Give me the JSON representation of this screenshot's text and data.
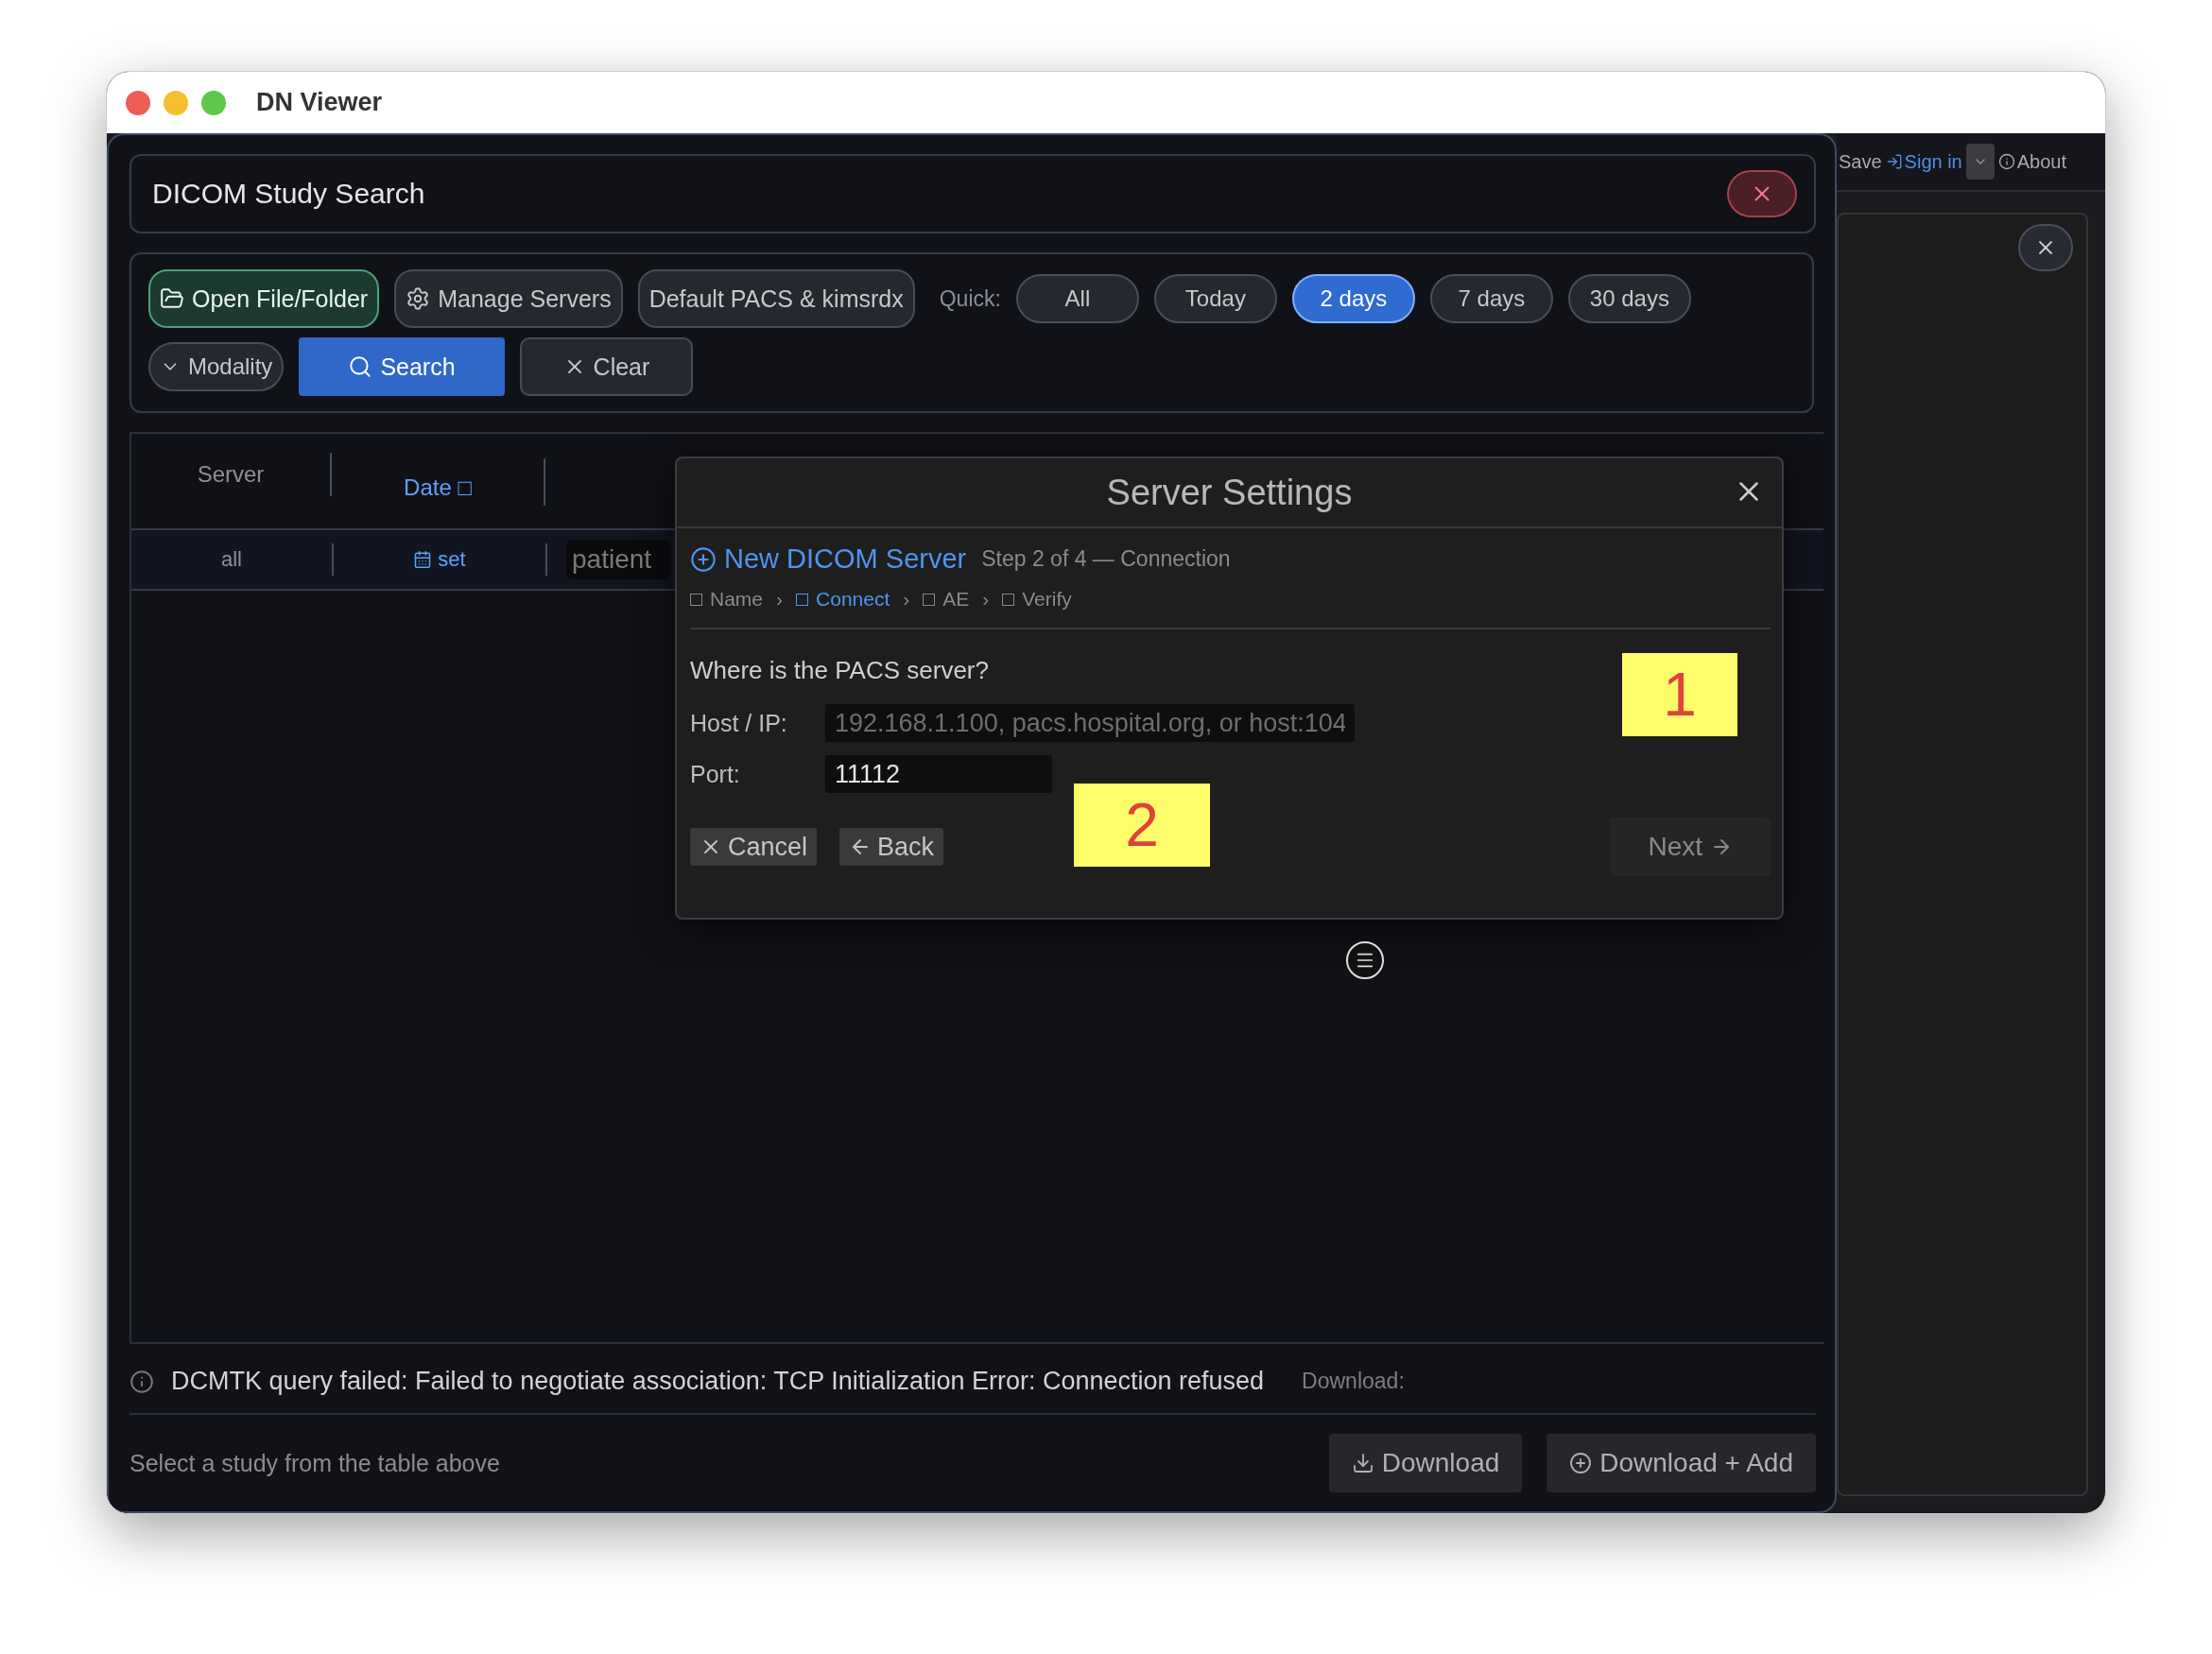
{
  "window": {
    "title": "DN Viewer"
  },
  "search_panel": {
    "title": "DICOM Study Search",
    "open_button": "Open File/Folder",
    "manage_button": "Manage Servers",
    "server_button": "Default PACS & kimsrdx",
    "quick_label": "Quick:",
    "quick_ranges": [
      {
        "label": "All",
        "selected": false
      },
      {
        "label": "Today",
        "selected": false
      },
      {
        "label": "2 days",
        "selected": true
      },
      {
        "label": "7 days",
        "selected": false
      },
      {
        "label": "30 days",
        "selected": false
      }
    ],
    "modality_button": "Modality",
    "search_button": "Search",
    "clear_button": "Clear"
  },
  "table": {
    "columns": [
      {
        "label": "Server",
        "sorted": false
      },
      {
        "label": "Date □",
        "sorted": true
      }
    ],
    "filters": {
      "server": "all",
      "date": "set",
      "patient_placeholder": "patient"
    }
  },
  "status": {
    "message": "DCMTK query failed: Failed to negotiate association: TCP Initialization Error: Connection refused",
    "download_label": "Download:"
  },
  "footer": {
    "hint": "Select a study from the table above",
    "download_button": "Download",
    "download_add_button": "Download + Add"
  },
  "side_panel": {
    "save": "Save",
    "sign_in": "Sign in",
    "about": "About"
  },
  "dialog": {
    "title": "Server Settings",
    "heading": "New DICOM Server",
    "step": "Step 2 of 4 — Connection",
    "steps": [
      {
        "label": "Name",
        "selected": false
      },
      {
        "label": "Connect",
        "selected": true,
        "separator": "›"
      },
      {
        "label": "AE",
        "selected": false,
        "separator": "›"
      },
      {
        "label": "Verify",
        "selected": false,
        "separator": "›"
      }
    ],
    "question": "Where is the PACS server?",
    "host": {
      "label": "Host / IP:",
      "placeholder": "192.168.1.100, pacs.hospital.org, or host:104"
    },
    "port": {
      "label": "Port:",
      "value": "11112"
    },
    "cancel_button": "Cancel",
    "back_button": "Back",
    "next_button": {
      "label": "Next",
      "disabled": true
    }
  },
  "callouts": [
    {
      "label": "1"
    },
    {
      "label": "2"
    }
  ]
}
